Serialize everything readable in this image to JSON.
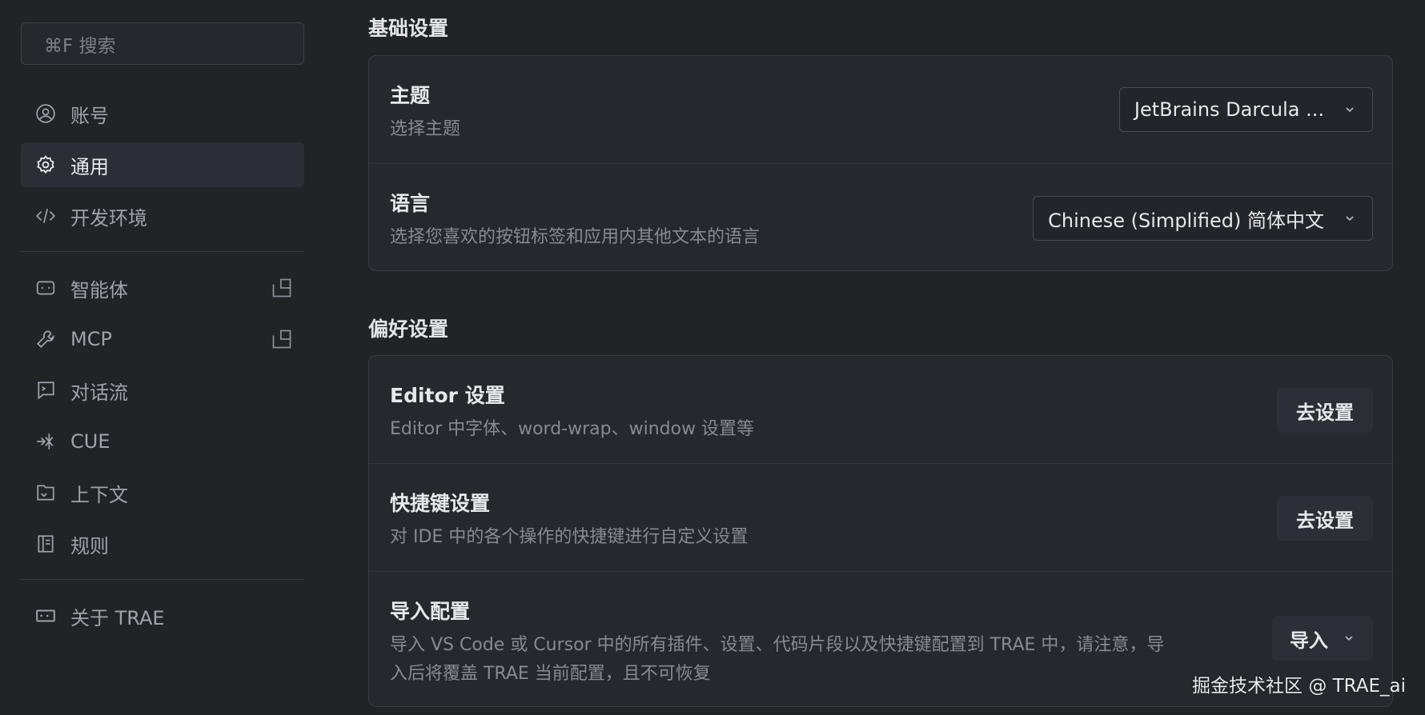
{
  "sidebar": {
    "search_text": "⌘F 搜索",
    "items": [
      {
        "label": "账号",
        "icon": "user-circle-icon",
        "active": false
      },
      {
        "label": "通用",
        "icon": "gear-icon",
        "active": true
      },
      {
        "label": "开发环境",
        "icon": "code-icon",
        "active": false
      },
      {
        "label": "智能体",
        "icon": "robot-icon",
        "active": false,
        "external": true
      },
      {
        "label": "MCP",
        "icon": "wrench-icon",
        "active": false,
        "external": true
      },
      {
        "label": "对话流",
        "icon": "chat-icon",
        "active": false
      },
      {
        "label": "CUE",
        "icon": "cue-icon",
        "active": false
      },
      {
        "label": "上下文",
        "icon": "context-icon",
        "active": false
      },
      {
        "label": "规则",
        "icon": "book-icon",
        "active": false
      },
      {
        "label": "关于 TRAE",
        "icon": "trae-logo-icon",
        "active": false
      }
    ]
  },
  "basic": {
    "title": "基础设置",
    "theme": {
      "title": "主题",
      "desc": "选择主题",
      "value": "JetBrains Darcula ..."
    },
    "language": {
      "title": "语言",
      "desc": "选择您喜欢的按钮标签和应用内其他文本的语言",
      "value": "Chinese (Simplified) 简体中文"
    }
  },
  "prefs": {
    "title": "偏好设置",
    "editor": {
      "title": "Editor 设置",
      "desc": "Editor 中字体、word-wrap、window 设置等",
      "button": "去设置"
    },
    "shortcuts": {
      "title": "快捷键设置",
      "desc": "对 IDE 中的各个操作的快捷键进行自定义设置",
      "button": "去设置"
    },
    "import": {
      "title": "导入配置",
      "desc_line1": "导入 VS Code 或 Cursor 中的所有插件、设置、代码片段以及快捷键配置到 TRAE 中，请注意，导",
      "desc_line2": "入后将覆盖 TRAE 当前配置，且不可恢复",
      "button": "导入"
    }
  },
  "watermark": "掘金技术社区 @ TRAE_ai",
  "colors": {
    "background": "#212327",
    "card": "#25282d",
    "active_item": "#2b2f35",
    "text_primary": "#e6e8eb",
    "text_secondary": "#868b93"
  }
}
